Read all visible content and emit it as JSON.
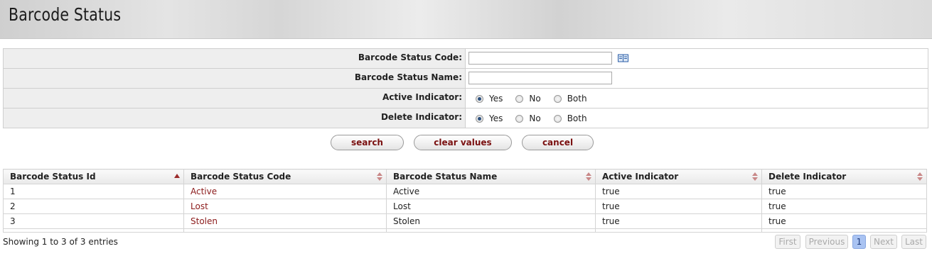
{
  "header": {
    "title": "Barcode Status"
  },
  "form": {
    "code_label": "Barcode Status Code:",
    "code_value": "",
    "name_label": "Barcode Status Name:",
    "name_value": "",
    "active_label": "Active Indicator:",
    "delete_label": "Delete Indicator:",
    "options": [
      "Yes",
      "No",
      "Both"
    ],
    "active_selected": "Yes",
    "delete_selected": "Yes"
  },
  "buttons": {
    "search": "search",
    "clear": "clear values",
    "cancel": "cancel"
  },
  "table": {
    "headers": [
      "Barcode Status Id",
      "Barcode Status Code",
      "Barcode Status Name",
      "Active Indicator",
      "Delete Indicator"
    ],
    "rows": [
      [
        "1",
        "Active",
        "Active",
        "true",
        "true"
      ],
      [
        "2",
        "Lost",
        "Lost",
        "true",
        "true"
      ],
      [
        "3",
        "Stolen",
        "Stolen",
        "true",
        "true"
      ]
    ]
  },
  "footer": {
    "info": "Showing 1 to 3 of 3 entries",
    "first": "First",
    "previous": "Previous",
    "page": "1",
    "next": "Next",
    "last": "Last"
  },
  "colors": {
    "link": "#8b1a1a",
    "button_text": "#7a1010",
    "current_page": "#a9c3f2"
  }
}
